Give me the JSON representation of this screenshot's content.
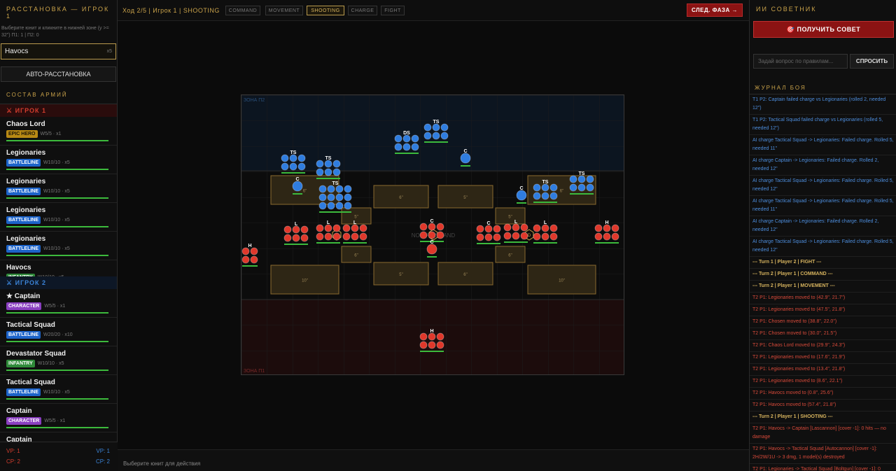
{
  "left": {
    "title": "РАССТАНОВКА — Игрок 1",
    "hint": "Выберите юнит и кликните в нижней зоне (y >= 32\") П1: 1 | П2: 0",
    "selected_unit": "Havocs",
    "selected_count": "x5",
    "auto_deploy": "АВТО-РАССТАНОВКА",
    "army_title": "СОСТАВ АРМИЙ",
    "player1_label": "⚔ ИГРОК 1",
    "player2_label": "⚔ ИГРОК 2",
    "player1_units": [
      {
        "name": "Chaos Lord",
        "badge": "EPIC HERO",
        "kind": "epic",
        "stats": "W5/5 · x1"
      },
      {
        "name": "Legionaries",
        "badge": "BATTLELINE",
        "kind": "bl",
        "stats": "W10/10 · x5"
      },
      {
        "name": "Legionaries",
        "badge": "BATTLELINE",
        "kind": "bl",
        "stats": "W10/10 · x5"
      },
      {
        "name": "Legionaries",
        "badge": "BATTLELINE",
        "kind": "bl",
        "stats": "W10/10 · x5"
      },
      {
        "name": "Legionaries",
        "badge": "BATTLELINE",
        "kind": "bl",
        "stats": "W10/10 · x5"
      },
      {
        "name": "Havocs",
        "badge": "INFANTRY",
        "kind": "inf",
        "stats": "W10/10 · x5"
      }
    ],
    "player2_units": [
      {
        "name": "★ Captain",
        "badge": "CHARACTER",
        "kind": "char",
        "stats": "W5/5 · x1"
      },
      {
        "name": "Tactical Squad",
        "badge": "BATTLELINE",
        "kind": "bl",
        "stats": "W20/20 · x10"
      },
      {
        "name": "Devastator Squad",
        "badge": "INFANTRY",
        "kind": "inf",
        "stats": "W10/10 · x5"
      },
      {
        "name": "Tactical Squad",
        "badge": "BATTLELINE",
        "kind": "bl",
        "stats": "W10/10 · x5"
      },
      {
        "name": "Captain",
        "badge": "CHARACTER",
        "kind": "char",
        "stats": "W5/5 · x1"
      },
      {
        "name": "Captain",
        "badge": "CHARACTER",
        "kind": "char",
        "stats": "W5/5 · x1"
      }
    ],
    "vp1": "VP: 1",
    "cp1": "CP: 2",
    "vp2": "VP: 1",
    "cp2": "CP: 2"
  },
  "top": {
    "turn": "Ход 2/5 | Игрок 1 | SHOOTING",
    "phases": [
      "COMMAND",
      "MOVEMENT",
      "SHOOTING",
      "CHARGE",
      "FIGHT"
    ],
    "active_phase": "SHOOTING",
    "next_phase": "СЛЕД. ФАЗА →"
  },
  "status": "Выберите юнит для действия",
  "board": {
    "zone_p2": "ЗОНА П2",
    "zone_p1": "ЗОНА П1",
    "center_label": "NO MAN'S LAND",
    "colors": {
      "p1": "#e0382b",
      "p2": "#2f7de0",
      "terrain": "#2e2615",
      "terrain_border": "#8a6a2e"
    },
    "terrain_labels": [
      "6\"",
      "5\"",
      "6\"",
      "5\"",
      "5\"",
      "6\"",
      "5\"",
      "6\"",
      "6\"",
      "6\"",
      "10\"",
      "10\""
    ],
    "objective_labels": [
      "B",
      "C",
      "D"
    ],
    "unit_labels": [
      "TS",
      "TS",
      "TS",
      "DS",
      "TS",
      "C",
      "C",
      "C",
      "TS",
      "TS",
      "L",
      "L",
      "L",
      "C",
      "C",
      "L",
      "L",
      "H",
      "H",
      "H",
      "C"
    ]
  },
  "right": {
    "title": "ИИ СОВЕТНИК",
    "get_advice": "🎯 ПОЛУЧИТЬ СОВЕТ",
    "question_placeholder": "Задай вопрос по правилам...",
    "ask": "СПРОСИТЬ",
    "log_title": "ЖУРНАЛ БОЯ",
    "log": [
      {
        "t": "T1 P2: Captain failed charge vs Legionaries (rolled 2, needed 12\")",
        "c": "blue"
      },
      {
        "t": "T1 P2: Tactical Squad failed charge vs Legionaries (rolled 5, needed 12\")",
        "c": "blue"
      },
      {
        "t": "AI charge Tactical Squad -> Legionaries: Failed charge. Rolled 5, needed 11\"",
        "c": "blue"
      },
      {
        "t": "AI charge Captain -> Legionaries: Failed charge. Rolled 2, needed 12\"",
        "c": "blue"
      },
      {
        "t": "AI charge Tactical Squad -> Legionaries: Failed charge. Rolled 5, needed 12\"",
        "c": "blue"
      },
      {
        "t": "AI charge Tactical Squad -> Legionaries: Failed charge. Rolled 5, needed 11\"",
        "c": "blue"
      },
      {
        "t": "AI charge Captain -> Legionaries: Failed charge. Rolled 2, needed 12\"",
        "c": "blue"
      },
      {
        "t": "AI charge Tactical Squad -> Legionaries: Failed charge. Rolled 5, needed 12\"",
        "c": "blue"
      },
      {
        "t": "--- Turn 1 | Player 2 | FIGHT ---",
        "c": "gold"
      },
      {
        "t": "--- Turn 2 | Player 1 | COMMAND ---",
        "c": "gold"
      },
      {
        "t": "--- Turn 2 | Player 1 | MOVEMENT ---",
        "c": "gold"
      },
      {
        "t": "T2 P1: Legionaries moved to (42.9\", 21.7\")",
        "c": "red"
      },
      {
        "t": "T2 P1: Legionaries moved to (47.5\", 21.8\")",
        "c": "red"
      },
      {
        "t": "T2 P1: Chosen moved to (38.8\", 22.0\")",
        "c": "red"
      },
      {
        "t": "T2 P1: Chosen moved to (30.0\", 21.5\")",
        "c": "red"
      },
      {
        "t": "T2 P1: Chaos Lord moved to (29.9\", 24.3\")",
        "c": "red"
      },
      {
        "t": "T2 P1: Legionaries moved to (17.6\", 21.9\")",
        "c": "red"
      },
      {
        "t": "T2 P1: Legionaries moved to (13.4\", 21.8\")",
        "c": "red"
      },
      {
        "t": "T2 P1: Legionaries moved to (8.6\", 22.1\")",
        "c": "red"
      },
      {
        "t": "T2 P1: Havocs moved to (0.8\", 25.6\")",
        "c": "red"
      },
      {
        "t": "T2 P1: Havocs moved to (57.4\", 21.8\")",
        "c": "red"
      },
      {
        "t": "--- Turn 2 | Player 1 | SHOOTING ---",
        "c": "gold"
      },
      {
        "t": "T2 P1: Havocs -> Captain [Lascannon] [cover -1]: 0 hits — no damage",
        "c": "red"
      },
      {
        "t": "T2 P1: Havocs -> Tactical Squad [Autocannon] [cover -1]: 2H/2W/1U -> 3 dmg, 1 model(s) destroyed",
        "c": "red"
      },
      {
        "t": "T2 P1: Legionaries -> Tactical Squad [Boltgun] [cover -1]: 0 wounds",
        "c": "red"
      }
    ]
  }
}
